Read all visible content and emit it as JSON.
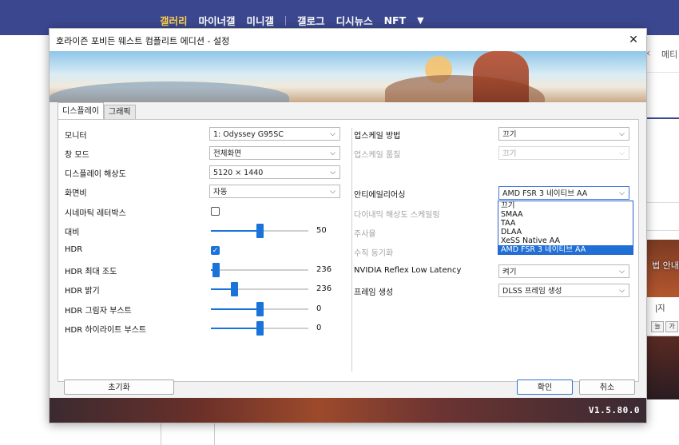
{
  "web": {
    "nav_items": [
      "갤러리",
      "마이너갤",
      "미니갤",
      "갤로그",
      "디시뉴스",
      "NFT"
    ],
    "nav_arrow": "▼",
    "tab_close": "×",
    "tab_label": "메티",
    "side_text_1": "법 안내",
    "side_text_2": "|지",
    "side_btn_1": "늘",
    "side_btn_2": "가"
  },
  "dialog": {
    "title": "호라이즌 포비든 웨스트 컴플리트 에디션 - 설정",
    "close_glyph": "✕",
    "tabs": [
      {
        "label": "디스플레이",
        "active": true
      },
      {
        "label": "그래픽",
        "active": false
      }
    ],
    "left": {
      "monitor": {
        "label": "모니터",
        "value": "1: Odyssey G95SC"
      },
      "window_mode": {
        "label": "창 모드",
        "value": "전체화면"
      },
      "resolution": {
        "label": "디스플레이 해상도",
        "value": "5120 × 1440"
      },
      "aspect": {
        "label": "화면비",
        "value": "자동"
      },
      "letterbox": {
        "label": "시네마틱 레터박스",
        "checked": false
      },
      "contrast": {
        "label": "대비",
        "value": "50",
        "fraction": 0.5
      },
      "hdr": {
        "label": "HDR",
        "checked": true,
        "check_glyph": "✓"
      },
      "hdr_max": {
        "label": "HDR 최대 조도",
        "value": "236",
        "fraction": 0.05
      },
      "hdr_brightness": {
        "label": "HDR 밝기",
        "value": "236",
        "fraction": 0.24
      },
      "hdr_shadow": {
        "label": "HDR 그림자 부스트",
        "value": "0",
        "fraction": 0.5
      },
      "hdr_highlight": {
        "label": "HDR 하이라이트 부스트",
        "value": "0",
        "fraction": 0.5
      }
    },
    "right": {
      "upscale_method": {
        "label": "업스케일 방법",
        "value": "끄기"
      },
      "upscale_quality": {
        "label": "업스케일 품질",
        "value": "끄기",
        "disabled": true
      },
      "antialiasing": {
        "label": "안티에일리어싱",
        "value": "AMD FSR 3 네이티브 AA"
      },
      "dynamic_res": {
        "label": "다이내믹 해상도 스케일링",
        "disabled": true
      },
      "sharpness": {
        "label": "주사율",
        "disabled": true
      },
      "vsync": {
        "label": "수직 동기화",
        "disabled": true
      },
      "reflex": {
        "label": "NVIDIA Reflex Low Latency",
        "value": "켜기"
      },
      "frame_gen": {
        "label": "프레임 생성",
        "value": "DLSS 프레임 생성"
      }
    },
    "aa_options": [
      "끄기",
      "SMAA",
      "TAA",
      "DLAA",
      "XeSS Native AA",
      "AMD FSR 3 네이티브 AA"
    ],
    "aa_selected_index": 5,
    "chevron": "⌵",
    "reset_label": "초기화",
    "ok_label": "확인",
    "cancel_label": "취소",
    "version": "V1.5.80.0"
  },
  "colors": {
    "accent": "#1a73d9",
    "nav_bg": "#3b4890",
    "nav_active": "#ffd24a"
  }
}
